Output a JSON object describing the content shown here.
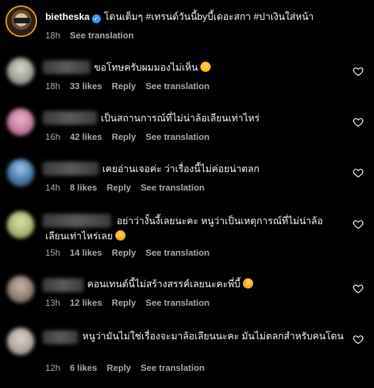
{
  "caption": {
    "username": "bietheska",
    "text": "โดนเต็มๆ #เทรนด์วันนี้byบี้เดอะสกา #ปาเงินใส่หน้า",
    "time": "18h",
    "see_translation": "See translation"
  },
  "labels": {
    "reply": "Reply",
    "see_translation": "See translation"
  },
  "comments": [
    {
      "text": "ขอโทษครับผมมองไม่เห็น",
      "emoji": "laughing-face",
      "time": "18h",
      "likes": "33 likes"
    },
    {
      "text": "เป็นสถานการณ์ที่ไม่น่าล้อเลียนเท่าไหร่",
      "time": "16h",
      "likes": "42 likes"
    },
    {
      "text": "เคยอ่านเจอค่ะ ว่าเรื่องนี้ไม่ค่อยน่าตลก",
      "time": "14h",
      "likes": "8 likes"
    },
    {
      "text": "อย่าว่างั้นงี้เลยนะคะ หนูว่าเป็นเหตุการณ์ที่ไม่น่าล้อเลียนเท่าไหร่เลย",
      "emoji": "pleading-face",
      "time": "15h",
      "likes": "14 likes"
    },
    {
      "text": "คอนเทนต์นี้ไม่สร้างสรรค์เลยนะคะพี่บี้",
      "emoji": "pleading-face",
      "time": "13h",
      "likes": "12 likes"
    },
    {
      "text": "หนูว่ามันไม่ใช่เรื่องจะมาล้อเลียนนะคะ มันไม่ตลกสำหรับคนโดน",
      "time": "12h",
      "likes": "6 likes"
    }
  ]
}
